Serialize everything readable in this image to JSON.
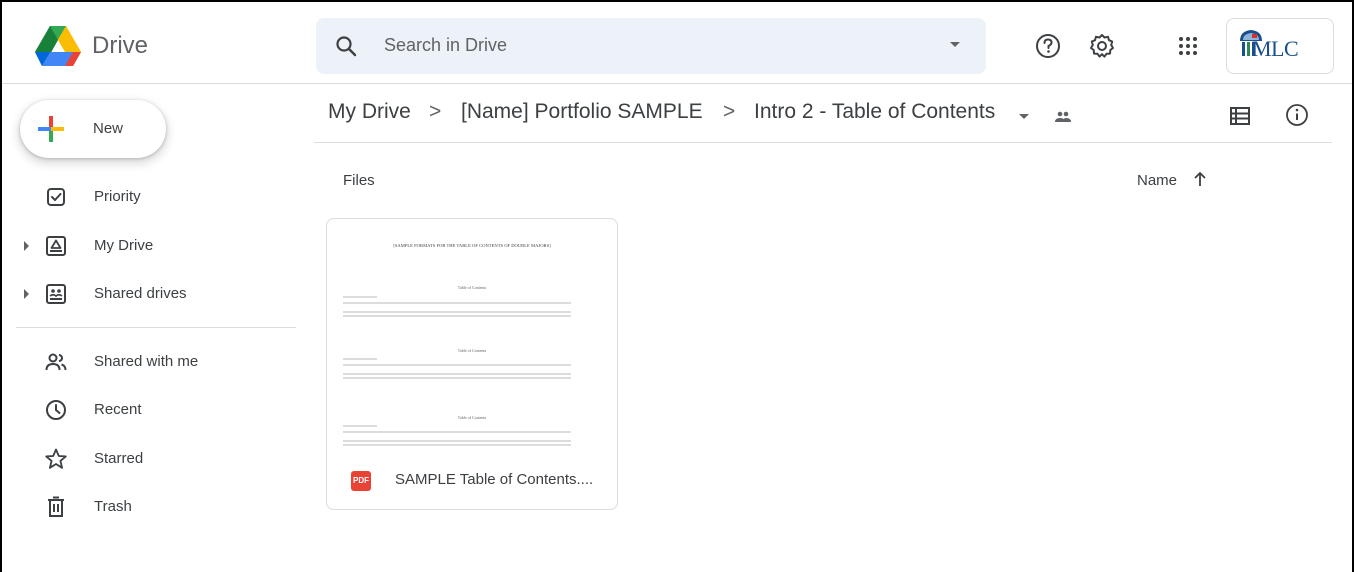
{
  "app": {
    "brand": "Drive"
  },
  "search": {
    "placeholder": "Search in Drive"
  },
  "header": {
    "org_label": "MLC"
  },
  "sidebar": {
    "new_label": "New",
    "items": [
      {
        "label": "Priority",
        "icon": "priority-icon"
      },
      {
        "label": "My Drive",
        "icon": "my-drive-icon"
      },
      {
        "label": "Shared drives",
        "icon": "shared-drives-icon"
      },
      {
        "label": "Shared with me",
        "icon": "shared-with-me-icon"
      },
      {
        "label": "Recent",
        "icon": "recent-icon"
      },
      {
        "label": "Starred",
        "icon": "star-icon"
      },
      {
        "label": "Trash",
        "icon": "trash-icon"
      }
    ]
  },
  "breadcrumb": {
    "items": [
      "My Drive",
      "[Name] Portfolio SAMPLE",
      "Intro 2 - Table of Contents"
    ],
    "separator": ">"
  },
  "content": {
    "section_label": "Files",
    "sort_label": "Name"
  },
  "files": [
    {
      "name": "SAMPLE Table of Contents....",
      "type_badge": "PDF"
    }
  ],
  "thumbnail": {
    "heading": "[SAMPLE FORMATS FOR THE TABLE OF CONTENTS OF DOUBLE MAJORS]",
    "toc_title": "Table of Contents"
  },
  "colors": {
    "search_bg": "#edf2f8",
    "divider": "#dadce0",
    "pdf_red": "#e94335",
    "google_blue": "#4285f4",
    "google_red": "#ea4335",
    "google_yellow": "#fbbc04",
    "google_green": "#34a853"
  }
}
